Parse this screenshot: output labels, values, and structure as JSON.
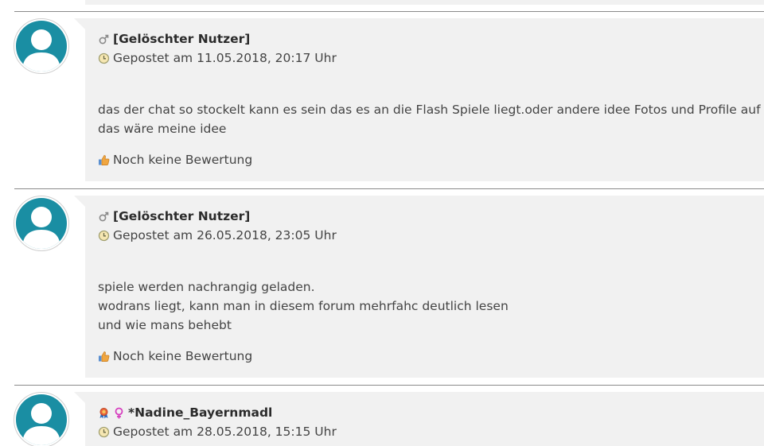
{
  "posts": [
    {
      "author": "[Gelöschter Nutzer]",
      "date": "Gepostet am 11.05.2018, 20:17 Uhr",
      "lines": [
        "das der chat so stockelt kann es sein das es an die Flash Spiele liegt.oder andere idee Fotos und Profile auf einem and",
        "das wäre meine idee"
      ],
      "rating": "Noch keine Bewertung"
    },
    {
      "author": "[Gelöschter Nutzer]",
      "date": "Gepostet am 26.05.2018, 23:05 Uhr",
      "lines": [
        "spiele werden nachrangig geladen.",
        "wodrans liegt, kann man in diesem forum mehrfahc deutlich lesen",
        "und wie mans behebt"
      ],
      "rating": "Noch keine Bewertung"
    },
    {
      "author": "*Nadine_Bayernmadl",
      "date": "Gepostet am 28.05.2018, 15:15 Uhr"
    }
  ],
  "icons": {
    "avatar": "default-avatar-silhouette",
    "male": "male-gender-icon",
    "female": "female-gender-icon",
    "clock": "clock-icon",
    "thumb": "thumbs-up-icon",
    "award": "award-ribbon-icon"
  },
  "colors": {
    "avatar_bg": "#1a8ea3",
    "bubble_bg": "#f1f1f1",
    "divider": "#8a8a8a",
    "female_icon": "#d63fbf"
  }
}
